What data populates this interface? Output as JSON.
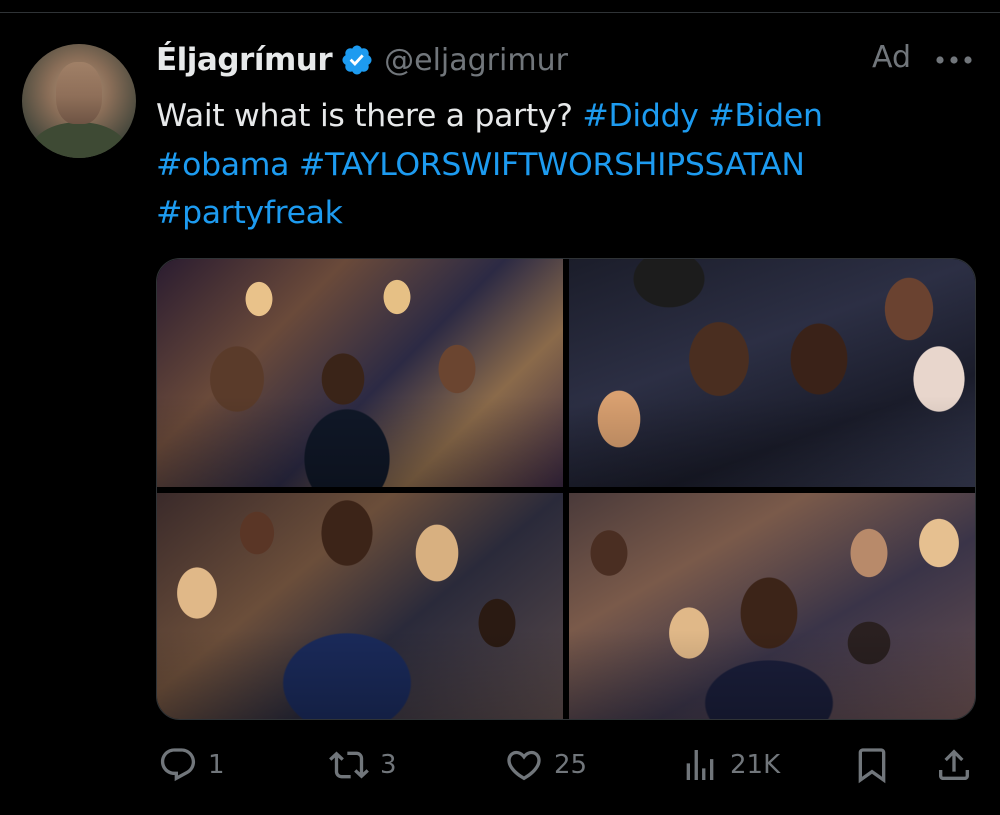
{
  "post": {
    "author": {
      "display_name": "Éljagrímur",
      "handle": "@eljagrimur",
      "verified_icon": "verified-badge-icon",
      "avatar_icon": "avatar-photo"
    },
    "ad_label": "Ad",
    "more_icon": "more-dots-icon",
    "text": {
      "plain": "Wait what is there a party?",
      "hashtags": [
        "#Diddy",
        "#Biden",
        "#obama",
        "#TAYLORSWIFTWORSHIPSSATAN",
        "#partyfreak"
      ]
    },
    "media": {
      "count": 4,
      "layout": "2x2 grid"
    },
    "actions": {
      "reply": {
        "icon": "reply-icon",
        "count": "1"
      },
      "retweet": {
        "icon": "retweet-icon",
        "count": "3"
      },
      "like": {
        "icon": "heart-icon",
        "count": "25"
      },
      "views": {
        "icon": "views-chart-icon",
        "count": "21K"
      },
      "bookmark": {
        "icon": "bookmark-icon"
      },
      "share": {
        "icon": "share-icon"
      }
    }
  },
  "colors": {
    "background": "#000000",
    "text_primary": "#e7e9ea",
    "text_secondary": "#71767b",
    "link": "#1d9bf0",
    "verified": "#1d9bf0",
    "divider": "#2f3336"
  }
}
